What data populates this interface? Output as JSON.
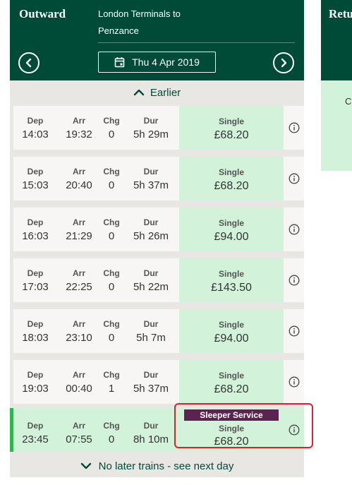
{
  "outward": {
    "title": "Outward",
    "route_line1": "London Terminals to",
    "route_line2": "Penzance",
    "date": "Thu 4 Apr 2019",
    "earlier_label": "Earlier",
    "later_label": "No later trains - see next day"
  },
  "return": {
    "title": "Return",
    "body_text": "Choose"
  },
  "labels": {
    "dep": "Dep",
    "arr": "Arr",
    "chg": "Chg",
    "dur": "Dur"
  },
  "journeys": [
    {
      "dep": "14:03",
      "arr": "19:32",
      "chg": "0",
      "dur": "5h 29m",
      "fare_type": "Single",
      "price": "£68.20"
    },
    {
      "dep": "15:03",
      "arr": "20:40",
      "chg": "0",
      "dur": "5h 37m",
      "fare_type": "Single",
      "price": "£68.20"
    },
    {
      "dep": "16:03",
      "arr": "21:29",
      "chg": "0",
      "dur": "5h 26m",
      "fare_type": "Single",
      "price": "£94.00"
    },
    {
      "dep": "17:03",
      "arr": "22:25",
      "chg": "0",
      "dur": "5h 22m",
      "fare_type": "Single",
      "price": "£143.50"
    },
    {
      "dep": "18:03",
      "arr": "23:10",
      "chg": "0",
      "dur": "5h 7m",
      "fare_type": "Single",
      "price": "£94.00"
    },
    {
      "dep": "19:03",
      "arr": "00:40",
      "chg": "1",
      "dur": "5h 37m",
      "fare_type": "Single",
      "price": "£68.20"
    },
    {
      "dep": "23:45",
      "arr": "07:55",
      "chg": "0",
      "dur": "8h 10m",
      "fare_type": "Single",
      "price": "£68.20",
      "badge": "Sleeper Service",
      "selected": true
    }
  ],
  "colors": {
    "brand_green": "#004b37",
    "fare_green": "#d2f2d9",
    "selected_bar": "#2db84b",
    "sleeper_badge": "#5a2350",
    "highlight_red": "#e0202a"
  },
  "icons": {
    "prev": "chevron-left-icon",
    "next": "chevron-right-icon",
    "calendar": "calendar-icon",
    "earlier": "chevron-up-icon",
    "later": "chevron-down-icon",
    "info": "info-icon"
  }
}
